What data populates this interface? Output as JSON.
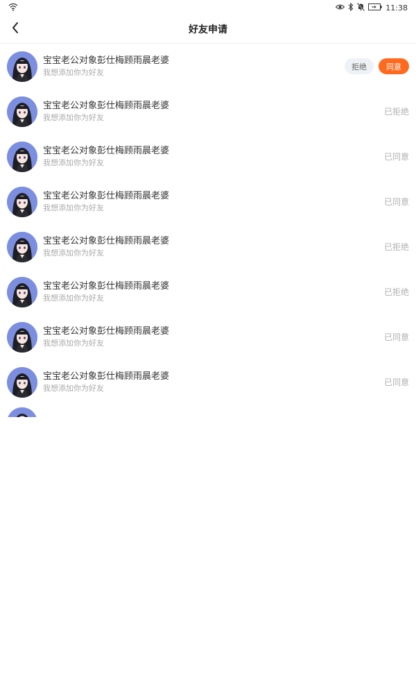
{
  "status_bar": {
    "time": "11:38",
    "icons": [
      "wifi-icon",
      "eye-icon",
      "bluetooth-icon",
      "mute-icon",
      "battery-icon"
    ]
  },
  "header": {
    "title": "好友申请",
    "back_icon": "chevron-left-icon"
  },
  "requests": [
    {
      "name": "宝宝老公对象彭仕梅顾雨晨老婆",
      "message": "我想添加你为好友",
      "reject_label": "拒绝",
      "agree_label": "同意"
    },
    {
      "name": "宝宝老公对象彭仕梅顾雨晨老婆",
      "message": "我想添加你为好友",
      "status": "已拒绝"
    },
    {
      "name": "宝宝老公对象彭仕梅顾雨晨老婆",
      "message": "我想添加你为好友",
      "status": "已同意"
    },
    {
      "name": "宝宝老公对象彭仕梅顾雨晨老婆",
      "message": "我想添加你为好友",
      "status": "已同意"
    },
    {
      "name": "宝宝老公对象彭仕梅顾雨晨老婆",
      "message": "我想添加你为好友",
      "status": "已拒绝"
    },
    {
      "name": "宝宝老公对象彭仕梅顾雨晨老婆",
      "message": "我想添加你为好友",
      "status": "已拒绝"
    },
    {
      "name": "宝宝老公对象彭仕梅顾雨晨老婆",
      "message": "我想添加你为好友",
      "status": "已同意"
    },
    {
      "name": "宝宝老公对象彭仕梅顾雨晨老婆",
      "message": "我想添加你为好友",
      "status": "已同意"
    }
  ],
  "colors": {
    "accent": "#ff6a1f",
    "reject_bg": "#eef1f5",
    "avatar_bg": "#7b8ee0"
  }
}
